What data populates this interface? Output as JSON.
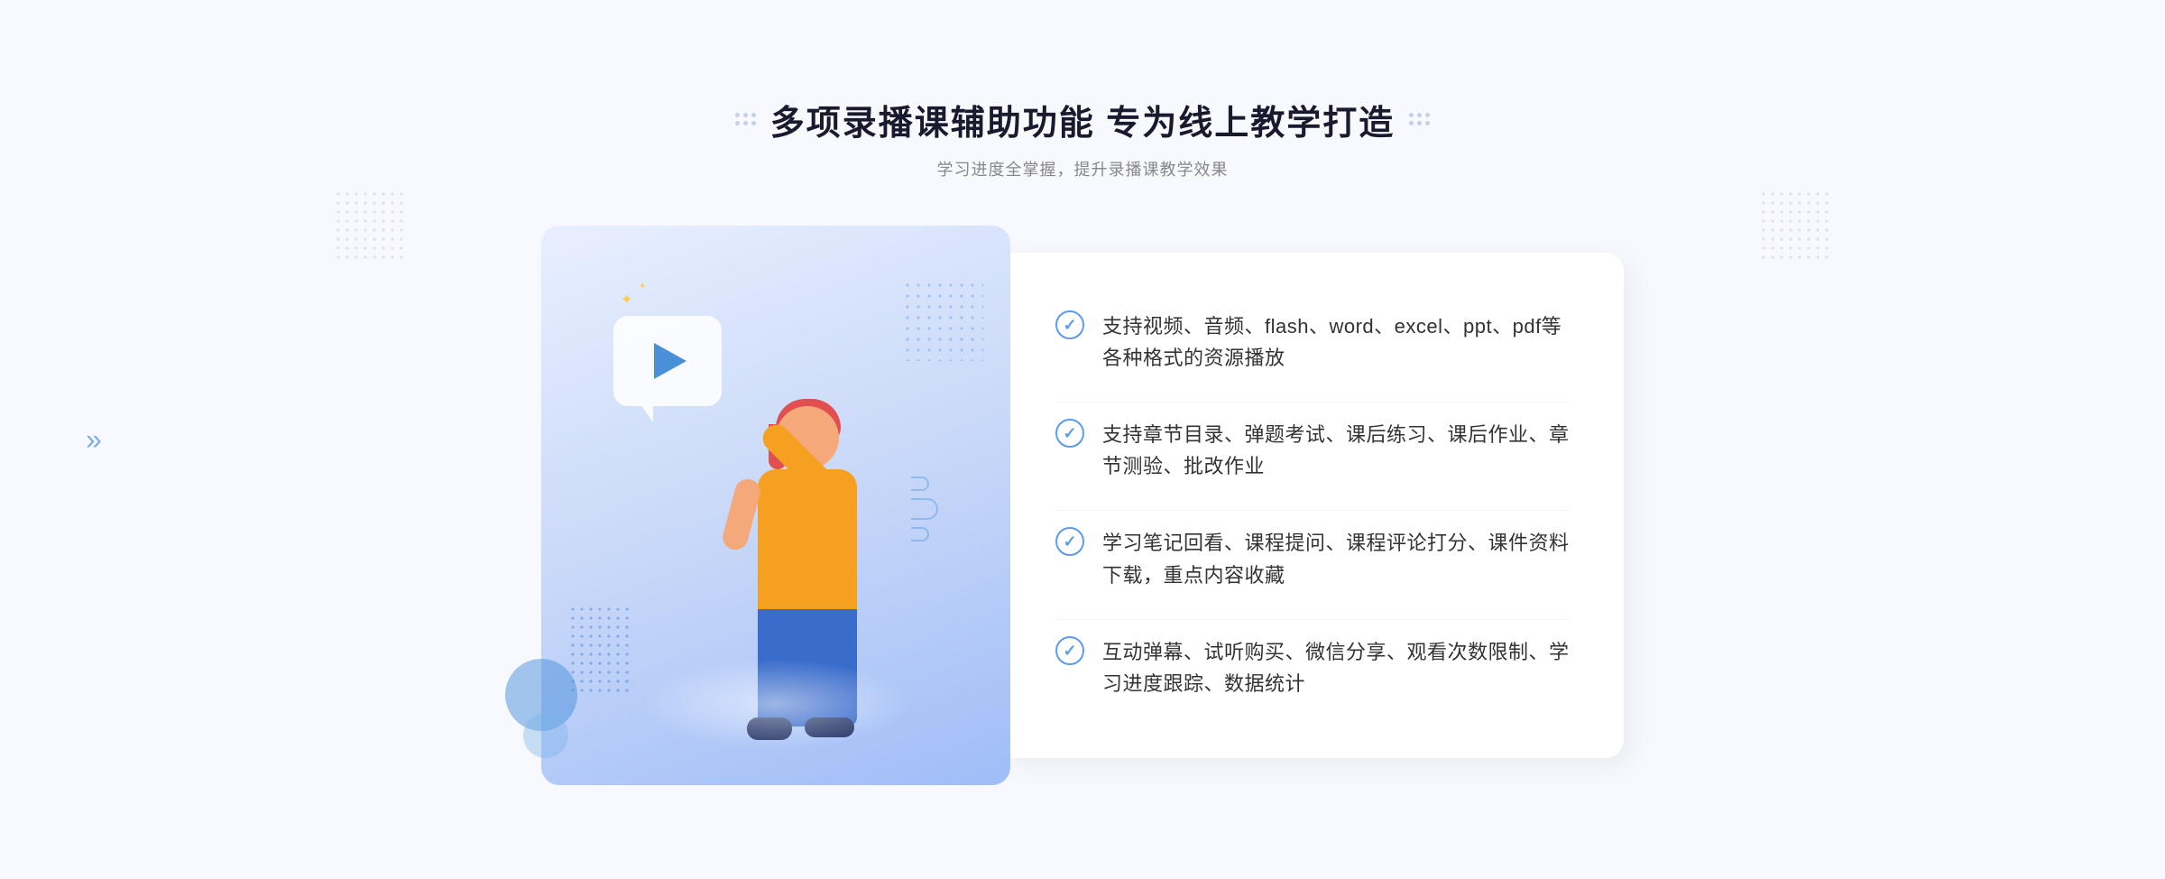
{
  "header": {
    "title": "多项录播课辅助功能 专为线上教学打造",
    "subtitle": "学习进度全掌握，提升录播课教学效果",
    "title_dots_left": "···",
    "title_dots_right": "···"
  },
  "features": [
    {
      "id": 1,
      "text": "支持视频、音频、flash、word、excel、ppt、pdf等各种格式的资源播放"
    },
    {
      "id": 2,
      "text": "支持章节目录、弹题考试、课后练习、课后作业、章节测验、批改作业"
    },
    {
      "id": 3,
      "text": "学习笔记回看、课程提问、课程评论打分、课件资料下载，重点内容收藏"
    },
    {
      "id": 4,
      "text": "互动弹幕、试听购买、微信分享、观看次数限制、学习进度跟踪、数据统计"
    }
  ],
  "navigation": {
    "chevron": "»"
  }
}
